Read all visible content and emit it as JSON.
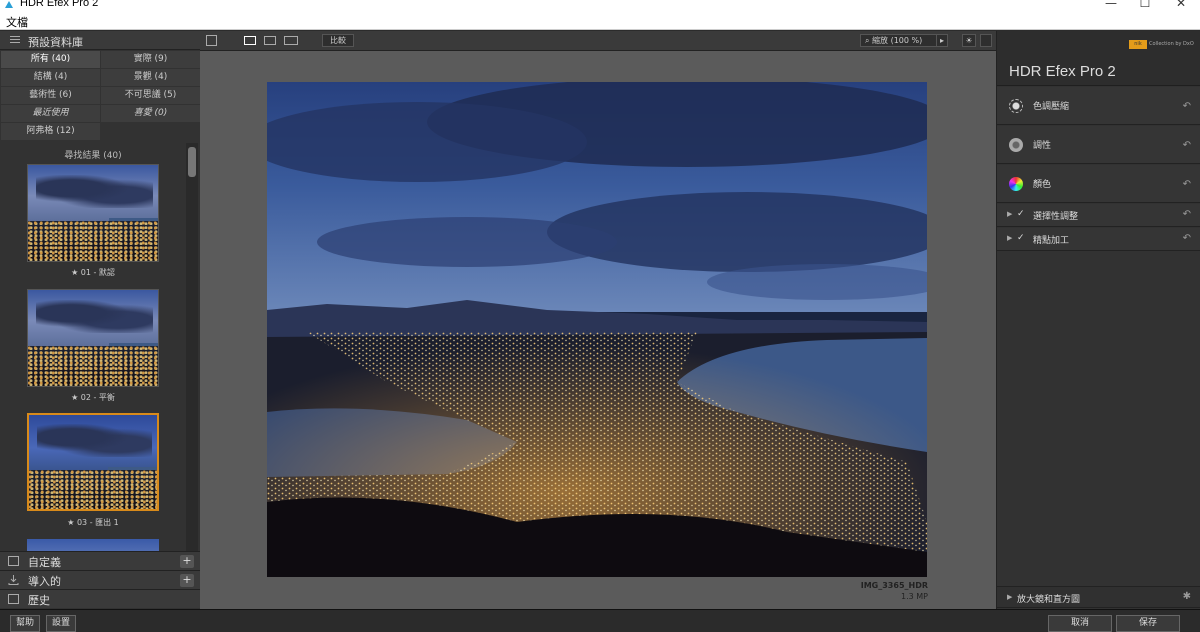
{
  "window": {
    "title": "HDR Efex Pro 2",
    "minimize": "—",
    "maximize": "☐",
    "close": "✕"
  },
  "menu": {
    "file": "文檔"
  },
  "library": {
    "header": "預設資料庫",
    "categories": [
      {
        "label": "所有 (40)",
        "active": true
      },
      {
        "label": "實際 (9)"
      },
      {
        "label": "結構 (4)"
      },
      {
        "label": "景觀 (4)"
      },
      {
        "label": "藝術性 (6)"
      },
      {
        "label": "不可思議 (5)"
      },
      {
        "label": "最近使用",
        "italic": true
      },
      {
        "label": "喜愛 (0)",
        "italic": true
      },
      {
        "label": "阿弗格 (12)"
      }
    ],
    "results_label": "尋找結果 (40)",
    "thumbnails": [
      {
        "caption": "★ 01 - 默認"
      },
      {
        "caption": "★ 02 - 平衡"
      },
      {
        "caption": "★ 03 - 匯出 1",
        "selected": true
      }
    ],
    "sections": [
      {
        "label": "自定義",
        "plus": "+"
      },
      {
        "label": "導入的",
        "plus": "+"
      },
      {
        "label": "歷史"
      }
    ]
  },
  "toolbar": {
    "compare": "比較",
    "zoom": "縮放 (100 %)"
  },
  "image": {
    "filename": "IMG_3365_HDR",
    "size": "1.3 MP"
  },
  "brand": {
    "nik": "nik",
    "collection": "Collection by DxO",
    "product": "HDR Efex Pro 2"
  },
  "panel": {
    "sections": [
      {
        "label": "色調壓縮",
        "icon": "sun-icon"
      },
      {
        "label": "調性",
        "icon": "aperture-icon"
      },
      {
        "label": "顏色",
        "icon": "color-wheel-icon"
      },
      {
        "label": "選擇性調整",
        "checked": true
      },
      {
        "label": "精點加工",
        "checked": true
      }
    ],
    "loupe": "放大鏡和直方圖"
  },
  "bottom": {
    "help": "幫助",
    "settings": "設置",
    "cancel": "取消",
    "save": "保存"
  }
}
